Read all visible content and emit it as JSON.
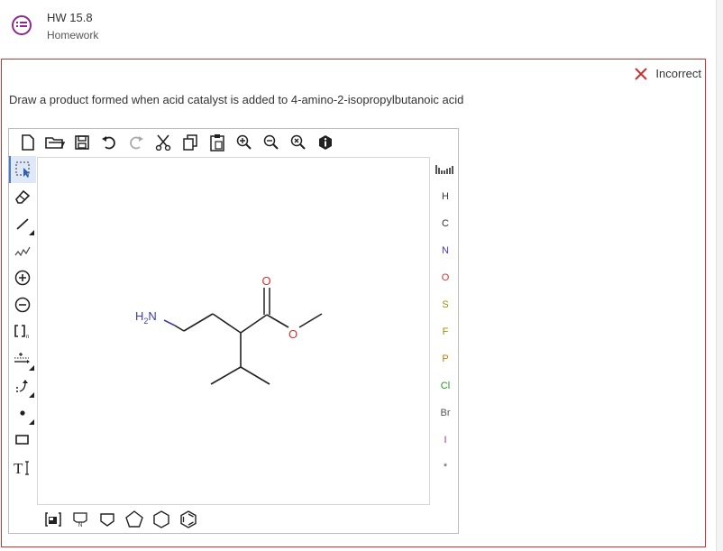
{
  "header": {
    "title": "HW 15.8",
    "subtitle": "Homework",
    "icon": "list-chat-icon"
  },
  "result": {
    "status": "Incorrect",
    "status_color": "#c83232"
  },
  "question": {
    "text": "Draw a product formed when acid catalyst is added to 4-amino-2-isopropylbutanoic acid"
  },
  "toolbar": {
    "icons": [
      "new-document-icon",
      "open-folder-icon",
      "save-icon",
      "undo-icon",
      "redo-icon",
      "cut-icon",
      "copy-icon",
      "paste-icon",
      "zoom-in-icon",
      "zoom-out-icon",
      "zoom-reset-icon",
      "info-icon"
    ]
  },
  "left_tools": [
    "select-tool",
    "eraser-tool",
    "single-bond-tool",
    "chain-tool",
    "positive-charge-tool",
    "negative-charge-tool",
    "bracket-tool",
    "reaction-arrow-tool",
    "mechanism-arrow-tool",
    "radical-tool",
    "rectangle-tool",
    "text-tool"
  ],
  "atoms": {
    "periodic_table_icon": "periodic-table-icon",
    "items": [
      {
        "symbol": "H",
        "color": "#333333"
      },
      {
        "symbol": "C",
        "color": "#333333"
      },
      {
        "symbol": "N",
        "color": "#3c3cb4"
      },
      {
        "symbol": "O",
        "color": "#d23232"
      },
      {
        "symbol": "S",
        "color": "#a08c00"
      },
      {
        "symbol": "F",
        "color": "#a08c00"
      },
      {
        "symbol": "P",
        "color": "#a08c00"
      },
      {
        "symbol": "Cl",
        "color": "#1e9b1e"
      },
      {
        "symbol": "Br",
        "color": "#555555"
      },
      {
        "symbol": "I",
        "color": "#8a3c8a"
      },
      {
        "symbol": "*",
        "color": "#555555"
      }
    ]
  },
  "molecule": {
    "amine_label_main": "H",
    "amine_label_sub": "2",
    "amine_label_n": "N",
    "carbonyl_o": "O",
    "ester_o": "O",
    "n_color": "#3c3cb4",
    "o_color": "#d23232"
  },
  "bottom_tools": [
    "template-library-icon",
    "fragment-icon",
    "cyclobutane-icon",
    "cyclopentane-icon",
    "cyclohexane-icon",
    "benzene-icon"
  ]
}
